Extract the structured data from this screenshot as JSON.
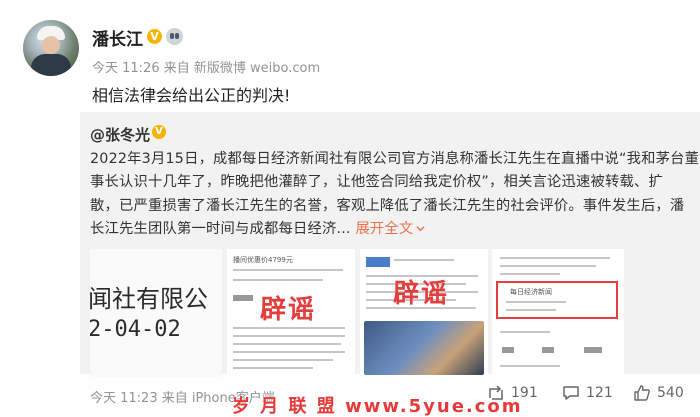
{
  "post": {
    "author": "潘长江",
    "meta": "今天 11:26 来自 新版微博 weibo.com",
    "text": "相信法律会给出公正的判决!"
  },
  "repost": {
    "author": "@张冬光",
    "lines": [
      "2022年3月15日，成都每日经济新闻社有限公司官方消息称潘长江先生在直播中说“我和茅台董",
      "事长认识十几年了，昨晚把他灌醉了，让他签合同给我定价权”，相关言论迅速被转载、扩",
      "散，已严重损害了潘长江先生的名誉，客观上降低了潘长江先生的社会评价。事件发生后，潘",
      "长江先生团队第一时间与成都每日经济..."
    ],
    "expand_label": "展开全文",
    "expand_icon": "chevron-down-icon",
    "images": {
      "img1_line1": "闻社有限公",
      "img1_line2": "2-04-02",
      "img2_stamp": "辟谣",
      "img2_caption": "播间优惠价4799元",
      "img3_stamp": "辟谣",
      "img4_caption": "每日经济新闻"
    }
  },
  "footer": {
    "meta": "今天 11:23 来自 iPhone客户端",
    "repost_count": "191",
    "comment_count": "121",
    "like_count": "540"
  },
  "watermark": "岁 月 联 盟  www.5yue.com",
  "colors": {
    "accent": "#eb7350",
    "badge": "#f5b400",
    "stamp": "#e33d3d"
  }
}
